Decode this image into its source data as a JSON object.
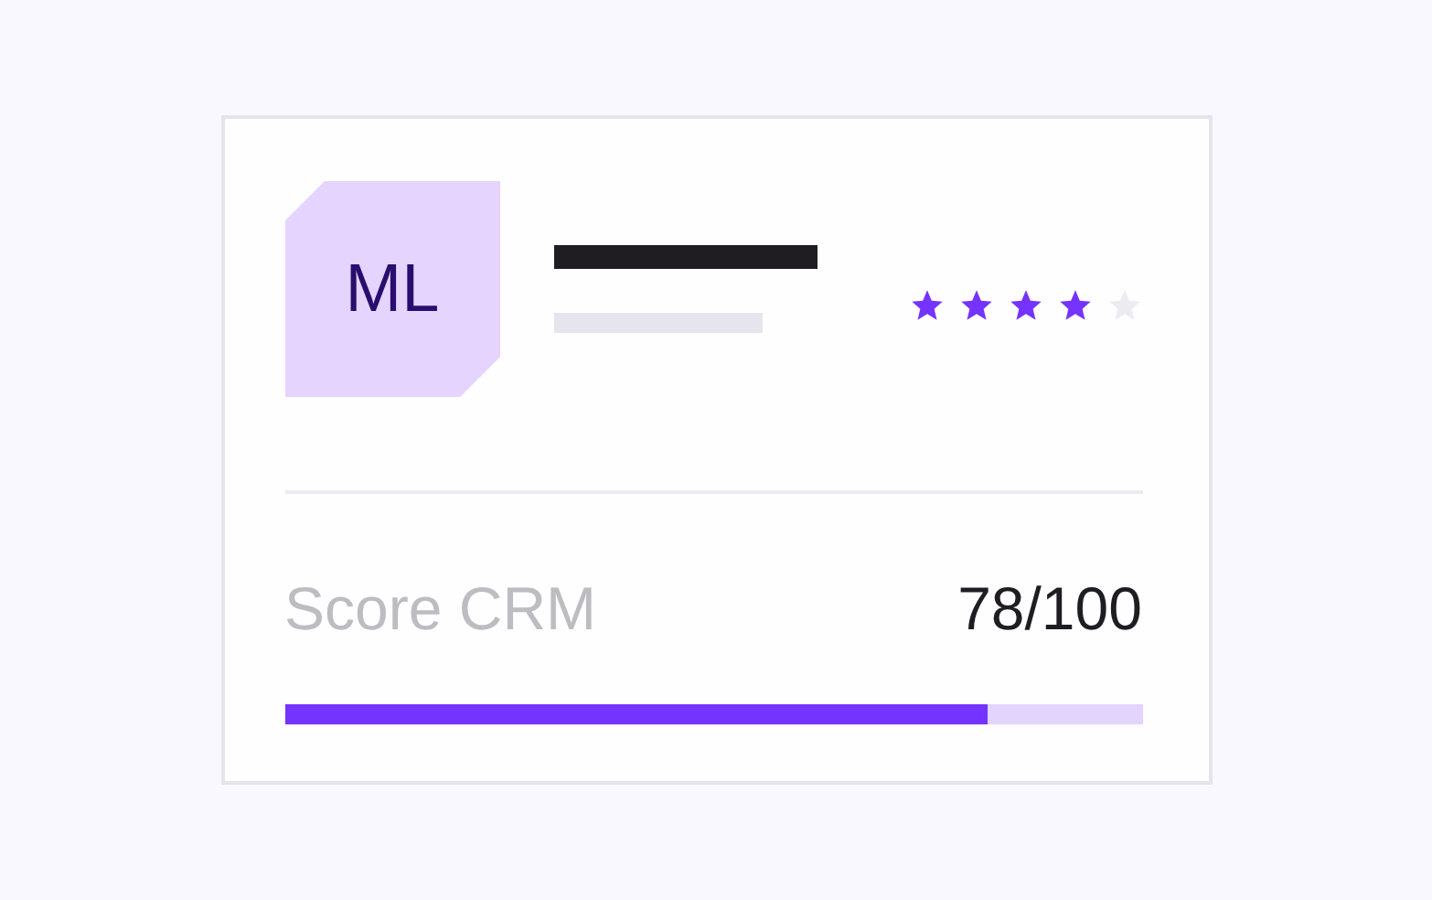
{
  "avatar": {
    "initials": "ML"
  },
  "rating": {
    "stars": 4
  },
  "score": {
    "label": "Score CRM",
    "value": "78/100",
    "level": 0.82
  }
}
